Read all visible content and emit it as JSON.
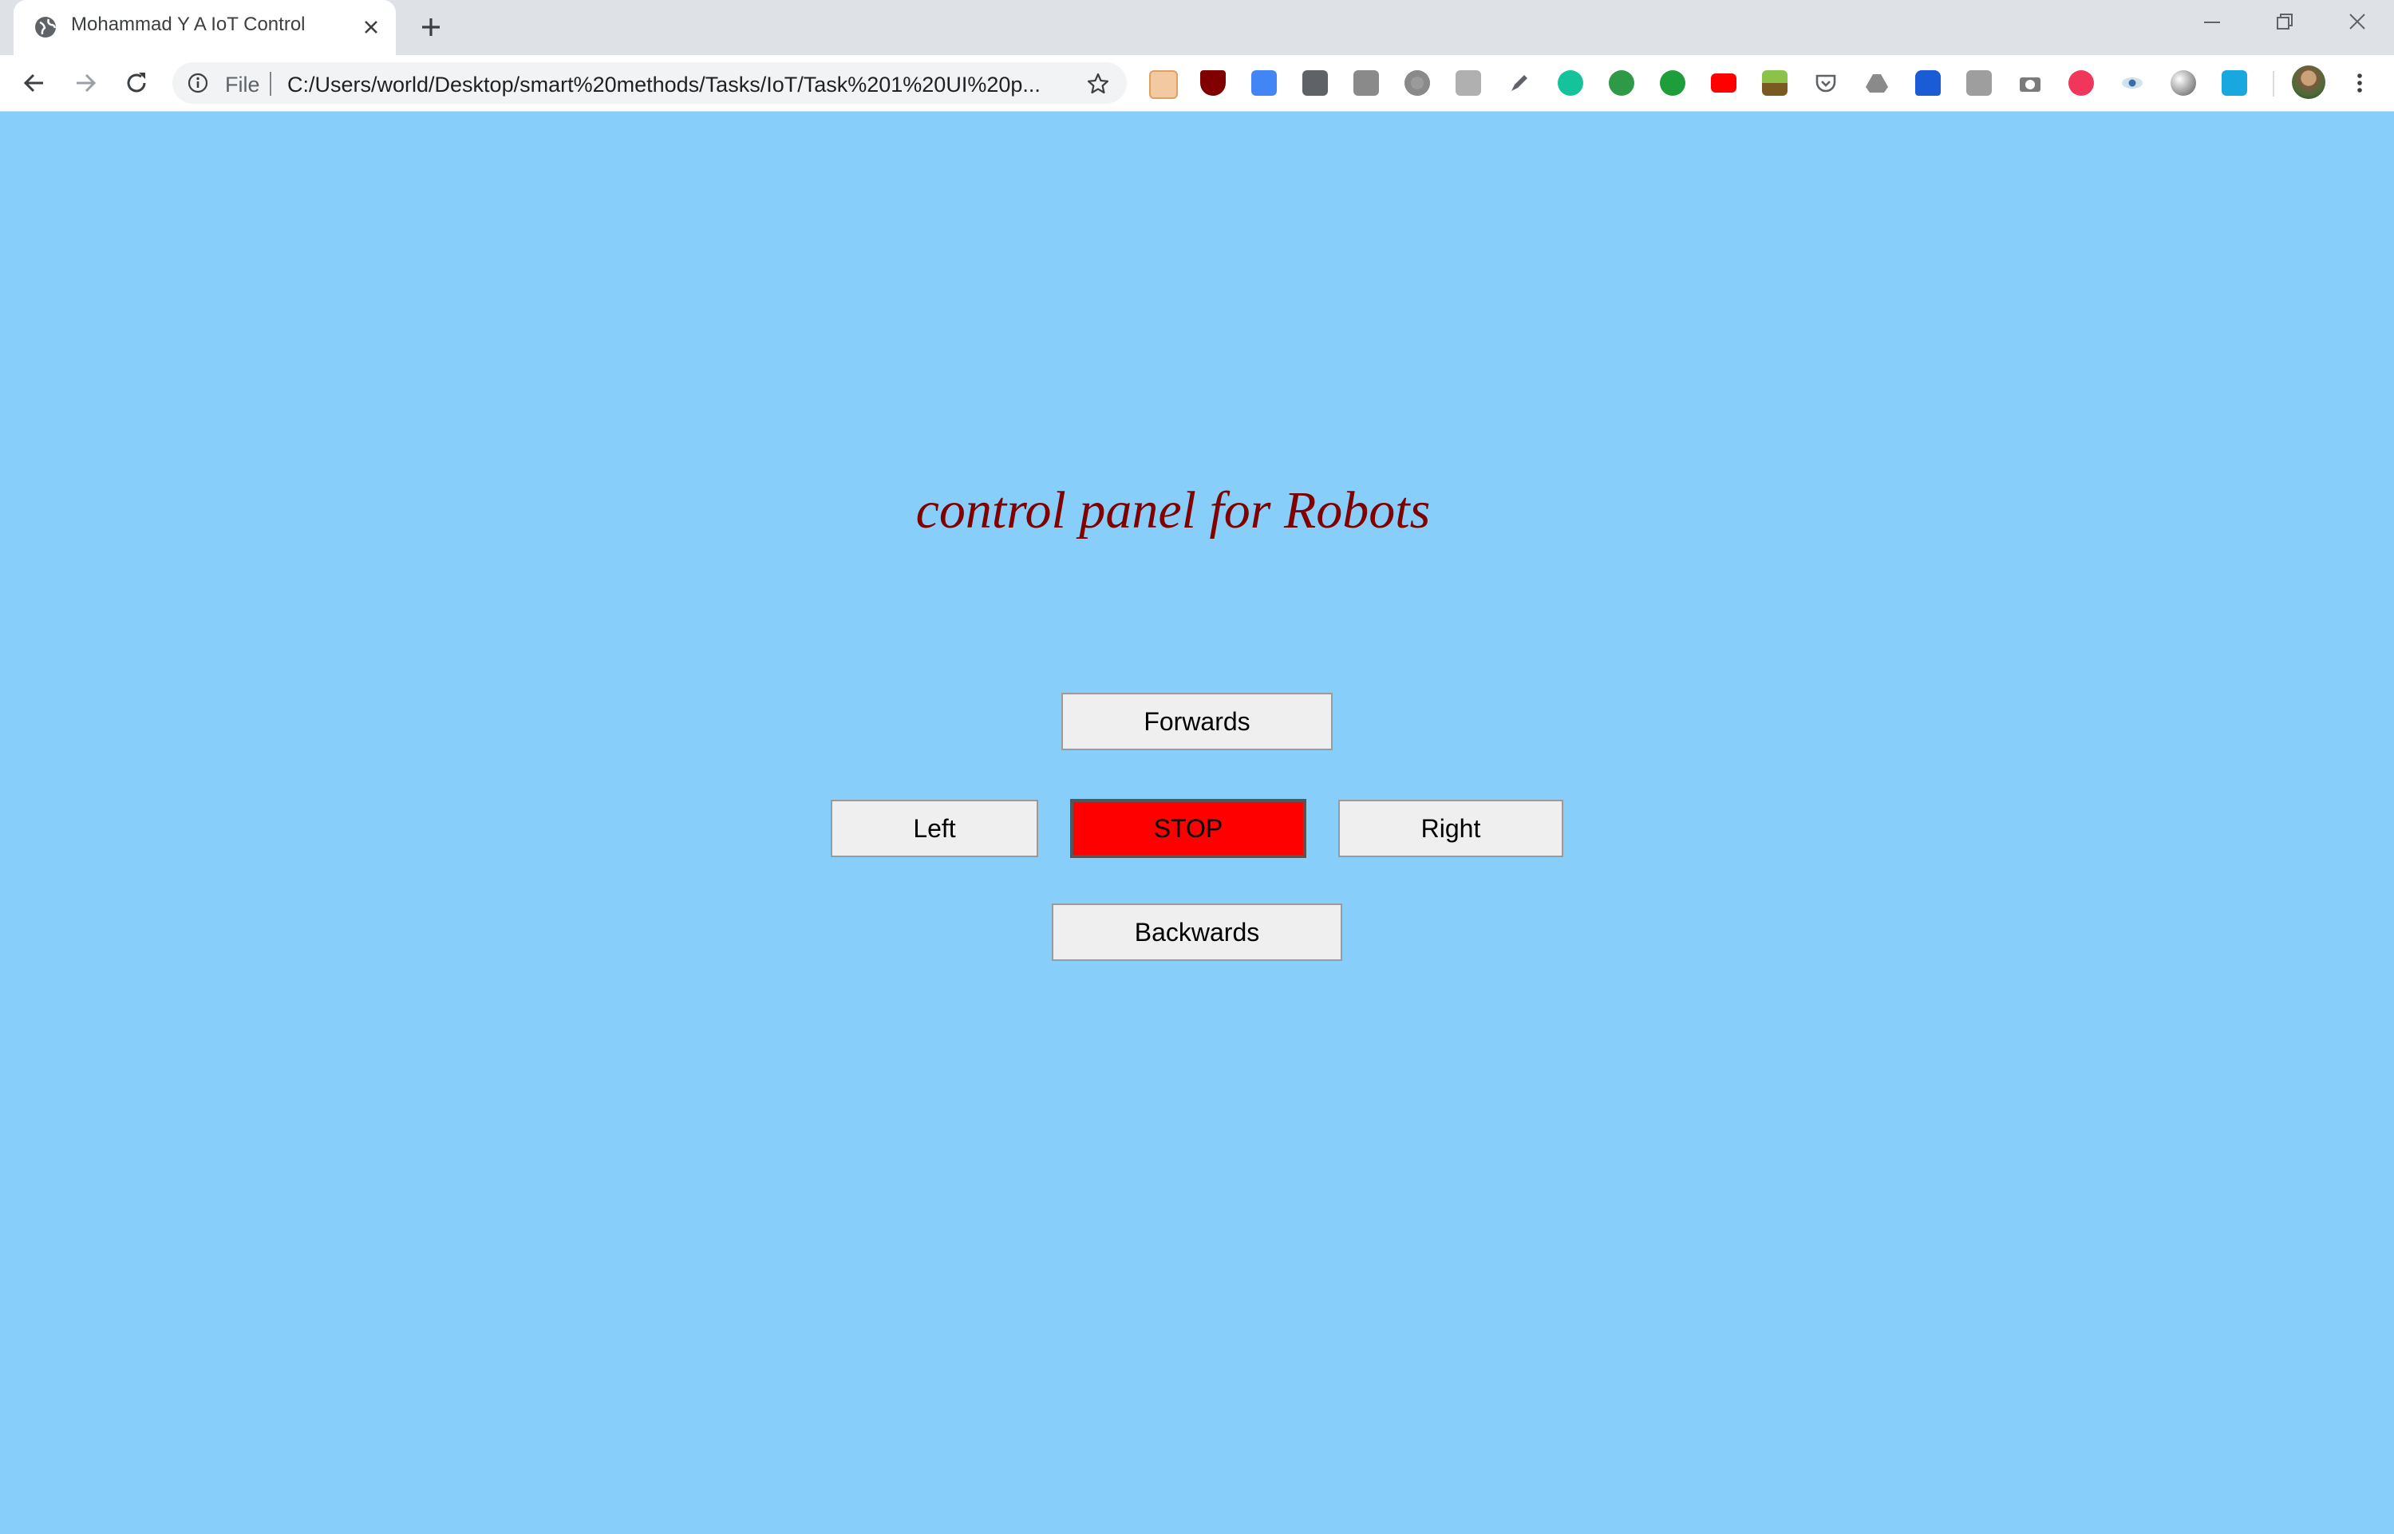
{
  "browser": {
    "tab_title": "Mohammad Y A IoT Control",
    "scheme_label": "File",
    "url": "C:/Users/world/Desktop/smart%20methods/Tasks/IoT/Task%201%20UI%20p..."
  },
  "page": {
    "heading": "control panel for Robots",
    "background_color": "#87cefa",
    "heading_color": "#800000"
  },
  "controls": {
    "forwards": "Forwards",
    "left": "Left",
    "stop": "STOP",
    "right": "Right",
    "backwards": "Backwards",
    "stop_color": "#ff0000"
  },
  "extensions": [
    "face-extension-icon",
    "ublock-icon",
    "google-translate-icon",
    "lightbulb-extension-icon",
    "pdf-extension-icon",
    "circle-extension-icon",
    "k-extension-icon",
    "highlighter-icon",
    "grammarly-icon",
    "grammar-check-icon",
    "checkmark-extension-icon",
    "youtube-extension-icon",
    "plant-extension-icon",
    "pocket-icon",
    "drive-icon",
    "malwarebytes-icon",
    "screenshot-extension-icon",
    "camera-icon",
    "t-extension-icon",
    "eye-extension-icon",
    "dark-mode-icon",
    "share-extension-icon"
  ]
}
